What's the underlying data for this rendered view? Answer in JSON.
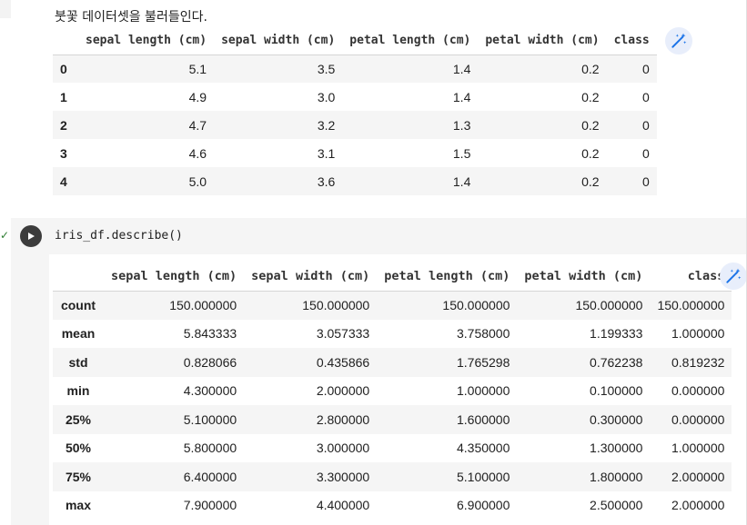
{
  "cell1": {
    "heading": "붓꽃 데이터셋을 불러들인다.",
    "columns": [
      "",
      "sepal length (cm)",
      "sepal width (cm)",
      "petal length (cm)",
      "petal width (cm)",
      "class"
    ],
    "rows": [
      {
        "index": "0",
        "values": [
          "5.1",
          "3.5",
          "1.4",
          "0.2",
          "0"
        ]
      },
      {
        "index": "1",
        "values": [
          "4.9",
          "3.0",
          "1.4",
          "0.2",
          "0"
        ]
      },
      {
        "index": "2",
        "values": [
          "4.7",
          "3.2",
          "1.3",
          "0.2",
          "0"
        ]
      },
      {
        "index": "3",
        "values": [
          "4.6",
          "3.1",
          "1.5",
          "0.2",
          "0"
        ]
      },
      {
        "index": "4",
        "values": [
          "5.0",
          "3.6",
          "1.4",
          "0.2",
          "0"
        ]
      }
    ]
  },
  "cell2": {
    "code": "iris_df.describe()",
    "status_mark": "✓",
    "columns": [
      "",
      "sepal length (cm)",
      "sepal width (cm)",
      "petal length (cm)",
      "petal width (cm)",
      "class"
    ],
    "rows": [
      {
        "index": "count",
        "values": [
          "150.000000",
          "150.000000",
          "150.000000",
          "150.000000",
          "150.000000"
        ]
      },
      {
        "index": "mean",
        "values": [
          "5.843333",
          "3.057333",
          "3.758000",
          "1.199333",
          "1.000000"
        ]
      },
      {
        "index": "std",
        "values": [
          "0.828066",
          "0.435866",
          "1.765298",
          "0.762238",
          "0.819232"
        ]
      },
      {
        "index": "min",
        "values": [
          "4.300000",
          "2.000000",
          "1.000000",
          "0.100000",
          "0.000000"
        ]
      },
      {
        "index": "25%",
        "values": [
          "5.100000",
          "2.800000",
          "1.600000",
          "0.300000",
          "0.000000"
        ]
      },
      {
        "index": "50%",
        "values": [
          "5.800000",
          "3.000000",
          "4.350000",
          "1.300000",
          "1.000000"
        ]
      },
      {
        "index": "75%",
        "values": [
          "6.400000",
          "3.300000",
          "5.100000",
          "1.800000",
          "2.000000"
        ]
      },
      {
        "index": "max",
        "values": [
          "7.900000",
          "4.400000",
          "6.900000",
          "2.500000",
          "2.000000"
        ]
      }
    ]
  },
  "icons": {
    "wand": "magic-wand-icon",
    "run": "play-icon"
  },
  "colors": {
    "wand_bg": "#e8eefb",
    "wand_fg": "#1a73e8",
    "run_bg": "#3c3c3c",
    "check": "#2e7d32"
  }
}
